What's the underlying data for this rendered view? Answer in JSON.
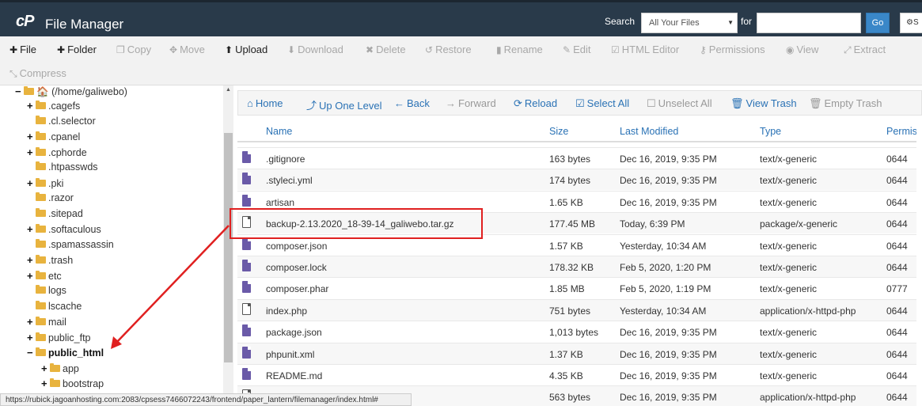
{
  "header": {
    "logo": "cP",
    "title": "File Manager",
    "search_label": "Search",
    "search_scope": "All Your Files",
    "for_label": "for",
    "search_value": "",
    "go_label": "Go",
    "settings_label": "S"
  },
  "toolbar": {
    "file": "File",
    "folder": "Folder",
    "copy": "Copy",
    "move": "Move",
    "upload": "Upload",
    "download": "Download",
    "delete": "Delete",
    "restore": "Restore",
    "rename": "Rename",
    "edit": "Edit",
    "html_editor": "HTML Editor",
    "permissions": "Permissions",
    "view": "View",
    "extract": "Extract",
    "compress": "Compress"
  },
  "tree": {
    "root": "(/home/galiwebo)",
    "items": [
      {
        "label": ".cagefs",
        "expand": "+"
      },
      {
        "label": ".cl.selector",
        "expand": ""
      },
      {
        "label": ".cpanel",
        "expand": "+"
      },
      {
        "label": ".cphorde",
        "expand": "+"
      },
      {
        "label": ".htpasswds",
        "expand": ""
      },
      {
        "label": ".pki",
        "expand": "+"
      },
      {
        "label": ".razor",
        "expand": ""
      },
      {
        "label": ".sitepad",
        "expand": ""
      },
      {
        "label": ".softaculous",
        "expand": "+"
      },
      {
        "label": ".spamassassin",
        "expand": ""
      },
      {
        "label": ".trash",
        "expand": "+"
      },
      {
        "label": "etc",
        "expand": "+"
      },
      {
        "label": "logs",
        "expand": ""
      },
      {
        "label": "lscache",
        "expand": ""
      },
      {
        "label": "mail",
        "expand": "+"
      },
      {
        "label": "public_ftp",
        "expand": "+"
      },
      {
        "label": "public_html",
        "expand": "−"
      },
      {
        "label": "app",
        "expand": "+"
      },
      {
        "label": "bootstrap",
        "expand": "+"
      }
    ]
  },
  "nav": {
    "home": "Home",
    "up": "Up One Level",
    "back": "Back",
    "forward": "Forward",
    "reload": "Reload",
    "select_all": "Select All",
    "unselect_all": "Unselect All",
    "view_trash": "View Trash",
    "empty_trash": "Empty Trash"
  },
  "table": {
    "headers": {
      "name": "Name",
      "size": "Size",
      "modified": "Last Modified",
      "type": "Type",
      "perms": "Permiss"
    },
    "rows": [
      {
        "name": ".gitignore",
        "size": "163 bytes",
        "modified": "Dec 16, 2019, 9:35 PM",
        "type": "text/x-generic",
        "perms": "0644"
      },
      {
        "name": ".styleci.yml",
        "size": "174 bytes",
        "modified": "Dec 16, 2019, 9:35 PM",
        "type": "text/x-generic",
        "perms": "0644"
      },
      {
        "name": "artisan",
        "size": "1.65 KB",
        "modified": "Dec 16, 2019, 9:35 PM",
        "type": "text/x-generic",
        "perms": "0644"
      },
      {
        "name": "backup-2.13.2020_18-39-14_galiwebo.tar.gz",
        "size": "177.45 MB",
        "modified": "Today, 6:39 PM",
        "type": "package/x-generic",
        "perms": "0644"
      },
      {
        "name": "composer.json",
        "size": "1.57 KB",
        "modified": "Yesterday, 10:34 AM",
        "type": "text/x-generic",
        "perms": "0644"
      },
      {
        "name": "composer.lock",
        "size": "178.32 KB",
        "modified": "Feb 5, 2020, 1:20 PM",
        "type": "text/x-generic",
        "perms": "0644"
      },
      {
        "name": "composer.phar",
        "size": "1.85 MB",
        "modified": "Feb 5, 2020, 1:19 PM",
        "type": "text/x-generic",
        "perms": "0777"
      },
      {
        "name": "index.php",
        "size": "751 bytes",
        "modified": "Yesterday, 10:34 AM",
        "type": "application/x-httpd-php",
        "perms": "0644"
      },
      {
        "name": "package.json",
        "size": "1,013 bytes",
        "modified": "Dec 16, 2019, 9:35 PM",
        "type": "text/x-generic",
        "perms": "0644"
      },
      {
        "name": "phpunit.xml",
        "size": "1.37 KB",
        "modified": "Dec 16, 2019, 9:35 PM",
        "type": "text/x-generic",
        "perms": "0644"
      },
      {
        "name": "README.md",
        "size": "4.35 KB",
        "modified": "Dec 16, 2019, 9:35 PM",
        "type": "text/x-generic",
        "perms": "0644"
      },
      {
        "name": "",
        "size": "563 bytes",
        "modified": "Dec 16, 2019, 9:35 PM",
        "type": "application/x-httpd-php",
        "perms": "0644"
      }
    ]
  },
  "status_url": "https://rubick.jagoanhosting.com:2083/cpsess7466072243/frontend/paper_lantern/filemanager/index.html#",
  "colors": {
    "header_bg": "#293a4a",
    "link": "#2a72b5",
    "folder": "#e8b33e",
    "file_icon": "#6a5aa8",
    "annotation": "#e02020"
  }
}
